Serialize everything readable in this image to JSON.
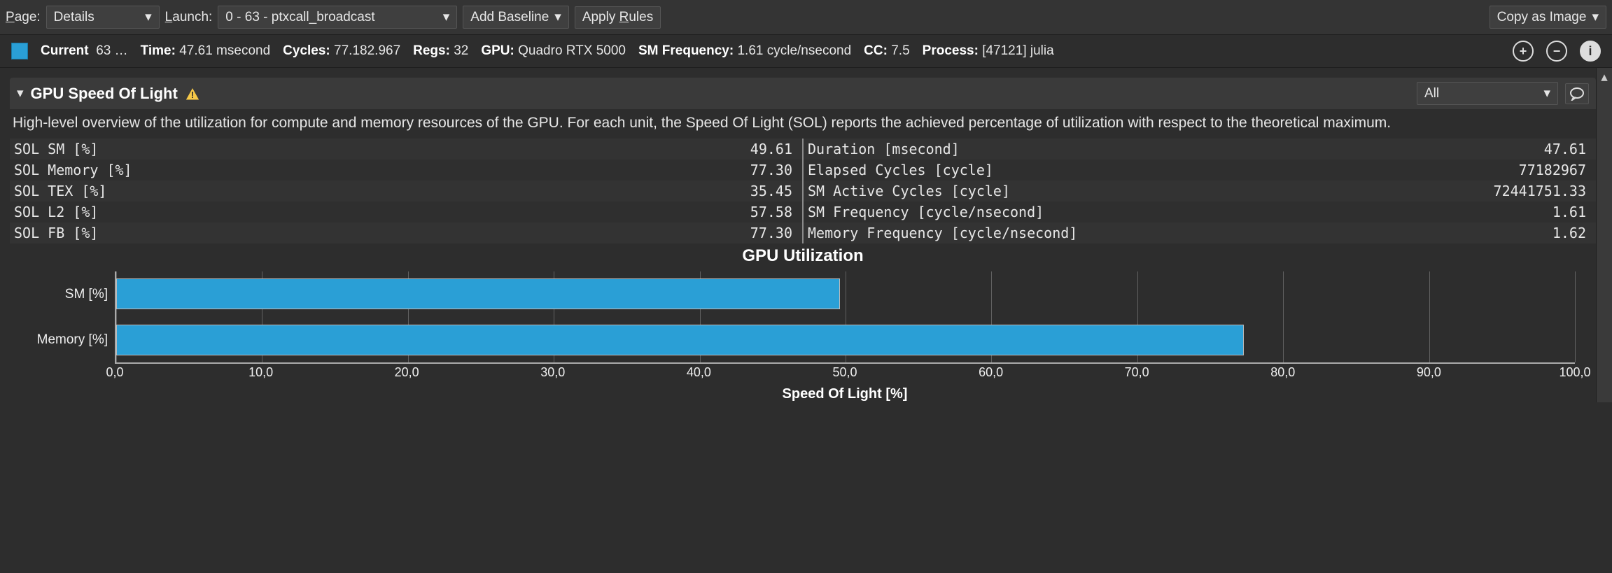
{
  "toolbar": {
    "page_label_pre": "P",
    "page_label_post": "age:",
    "page_value": "Details",
    "launch_label_pre": "L",
    "launch_label_post": "aunch:",
    "launch_value": "0 -   63 - ptxcall_broadcast",
    "add_baseline": "Add Baseline",
    "apply_rules_pre": "Apply ",
    "apply_rules_u": "R",
    "apply_rules_post": "ules",
    "copy_image": "Copy as Image"
  },
  "info": {
    "current_label": "Current",
    "current_value": "63 …",
    "time_label": "Time:",
    "time_value": "47.61 msecond",
    "cycles_label": "Cycles:",
    "cycles_value": "77.182.967",
    "regs_label": "Regs:",
    "regs_value": "32",
    "gpu_label": "GPU:",
    "gpu_value": "Quadro RTX 5000",
    "smfreq_label": "SM Frequency:",
    "smfreq_value": "1.61 cycle/nsecond",
    "cc_label": "CC:",
    "cc_value": "7.5",
    "process_label": "Process:",
    "process_value": "[47121] julia"
  },
  "section": {
    "title": "GPU Speed Of Light",
    "filter": "All",
    "description": "High-level overview of the utilization for compute and memory resources of the GPU. For each unit, the Speed Of Light (SOL) reports the achieved percentage of utilization with respect to the theoretical maximum."
  },
  "metrics_left": [
    {
      "label": "SOL SM [%]",
      "value": "49.61"
    },
    {
      "label": "SOL Memory [%]",
      "value": "77.30"
    },
    {
      "label": "SOL TEX [%]",
      "value": "35.45"
    },
    {
      "label": "SOL L2 [%]",
      "value": "57.58"
    },
    {
      "label": "SOL FB [%]",
      "value": "77.30"
    }
  ],
  "metrics_right": [
    {
      "label": "Duration [msecond]",
      "value": "47.61"
    },
    {
      "label": "Elapsed Cycles [cycle]",
      "value": "77182967"
    },
    {
      "label": "SM Active Cycles [cycle]",
      "value": "72441751.33"
    },
    {
      "label": "SM Frequency [cycle/nsecond]",
      "value": "1.61"
    },
    {
      "label": "Memory Frequency [cycle/nsecond]",
      "value": "1.62"
    }
  ],
  "chart_data": {
    "type": "bar",
    "orientation": "horizontal",
    "title": "GPU Utilization",
    "xlabel": "Speed Of Light [%]",
    "ylabel": "",
    "xlim": [
      0,
      100
    ],
    "categories": [
      "SM [%]",
      "Memory [%]"
    ],
    "values": [
      49.61,
      77.3
    ],
    "ticks": [
      "0,0",
      "10,0",
      "20,0",
      "30,0",
      "40,0",
      "50,0",
      "60,0",
      "70,0",
      "80,0",
      "90,0",
      "100,0"
    ]
  }
}
